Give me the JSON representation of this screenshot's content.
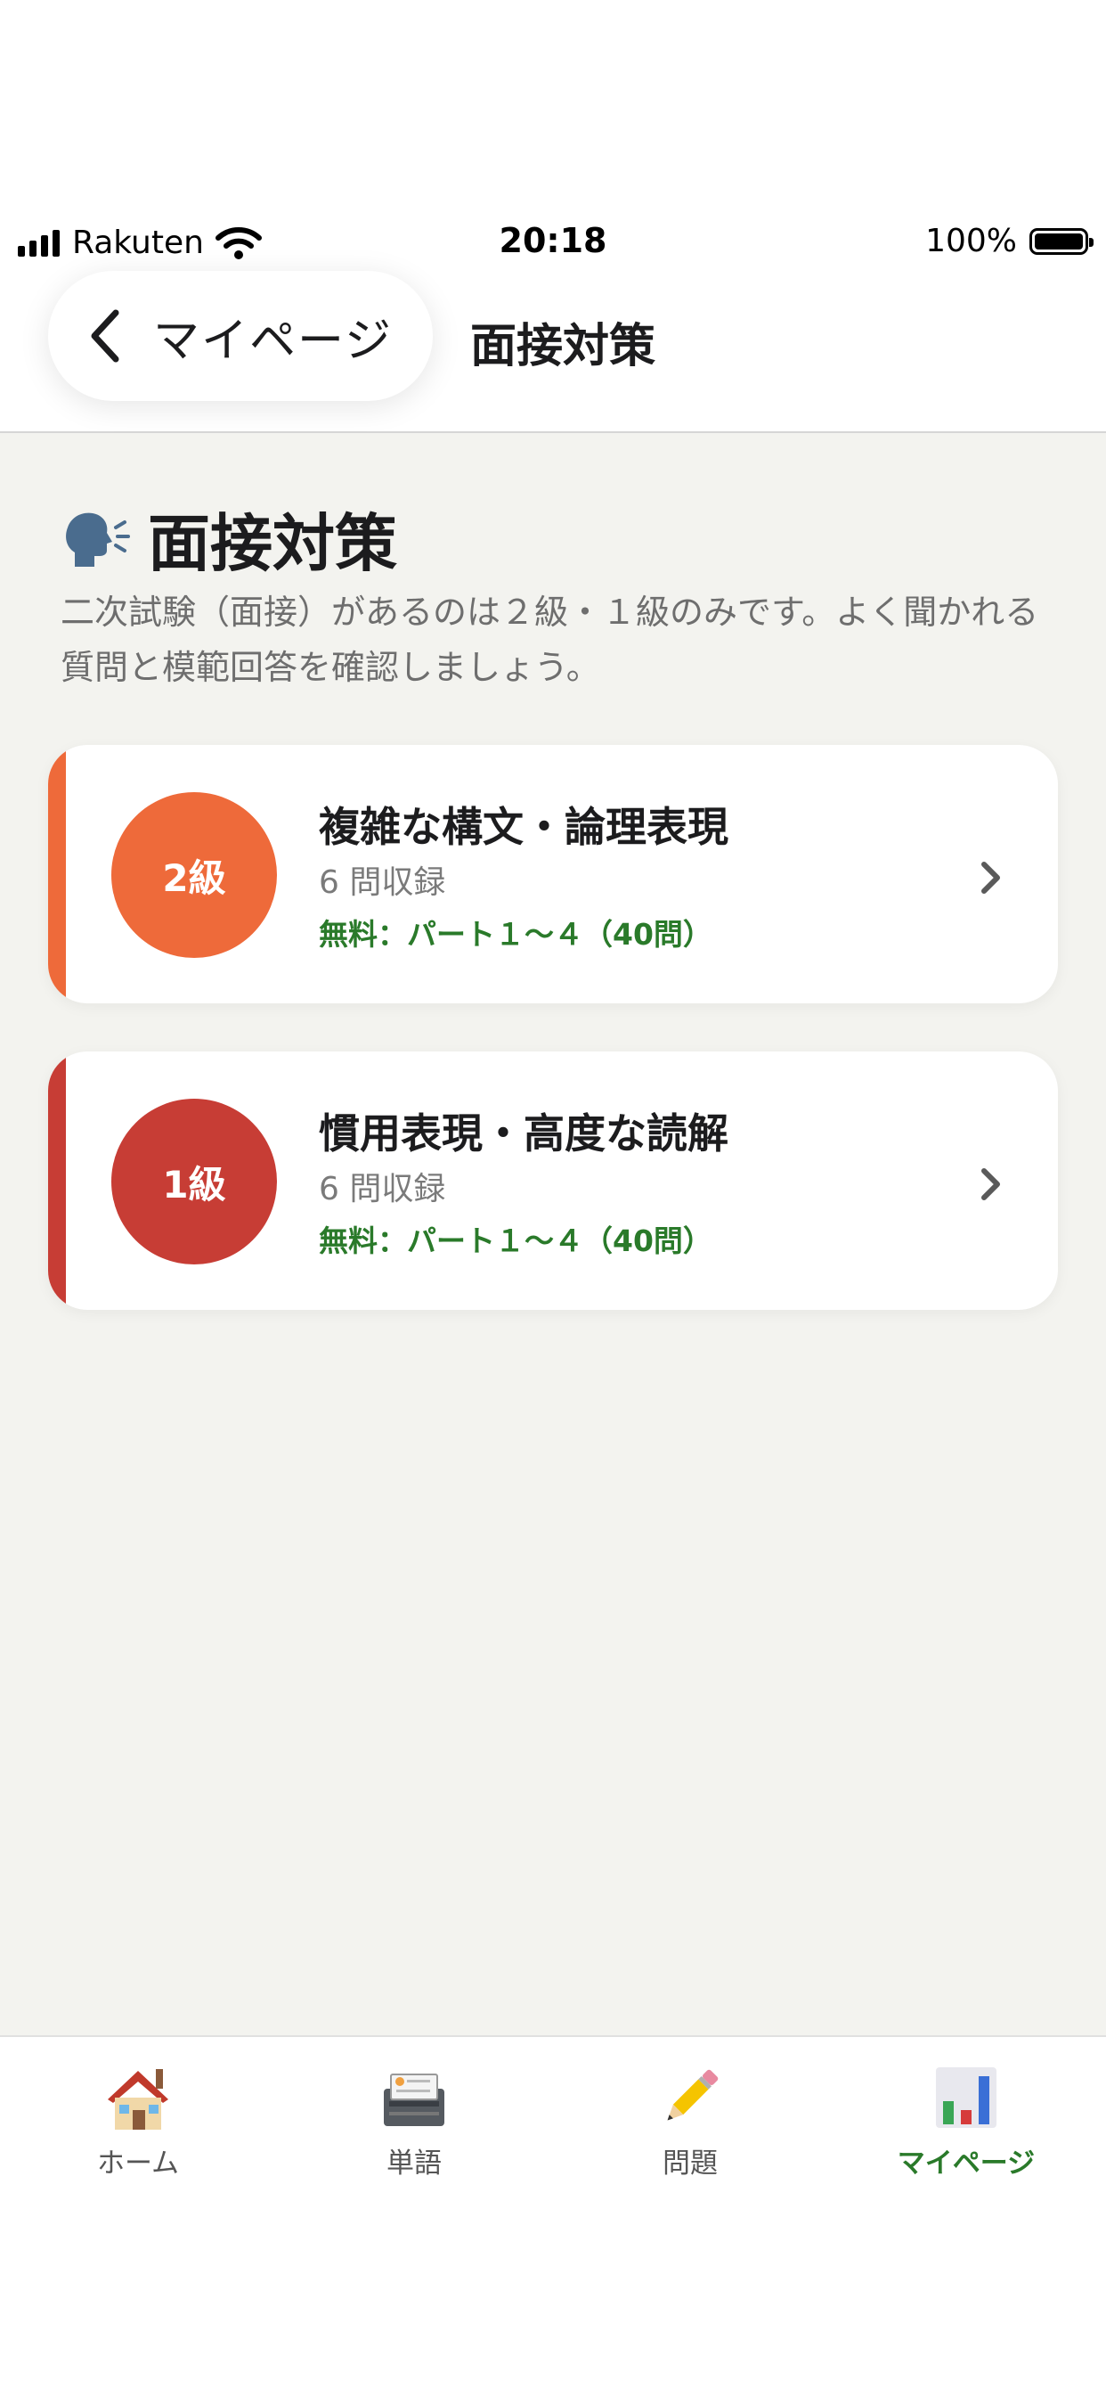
{
  "status_bar": {
    "carrier": "Rakuten",
    "time": "20:18",
    "battery": "100%"
  },
  "nav": {
    "back_label": "マイページ",
    "title": "面接対策"
  },
  "page": {
    "heading_icon": "speaking-head-icon",
    "heading": "面接対策",
    "description": "二次試験（面接）があるのは２級・１級のみです。よく聞かれる質問と模範回答を確認しましょう。"
  },
  "cards": [
    {
      "badge": "2級",
      "title": "複雑な構文・論理表現",
      "count": "6 問収録",
      "free": "無料：パート１〜４（40問）",
      "color": "#ee6a3a"
    },
    {
      "badge": "1級",
      "title": "慣用表現・高度な読解",
      "count": "6 問収録",
      "free": "無料：パート１〜４（40問）",
      "color": "#c73d35"
    }
  ],
  "tabs": [
    {
      "label": "ホーム",
      "icon": "house-icon",
      "active": false
    },
    {
      "label": "単語",
      "icon": "card-index-icon",
      "active": false
    },
    {
      "label": "問題",
      "icon": "pencil-icon",
      "active": false
    },
    {
      "label": "マイページ",
      "icon": "bar-chart-icon",
      "active": true
    }
  ],
  "colors": {
    "background": "#f3f3ef",
    "free_text": "#2a7a2a",
    "active_tab": "#2a7a2a"
  }
}
